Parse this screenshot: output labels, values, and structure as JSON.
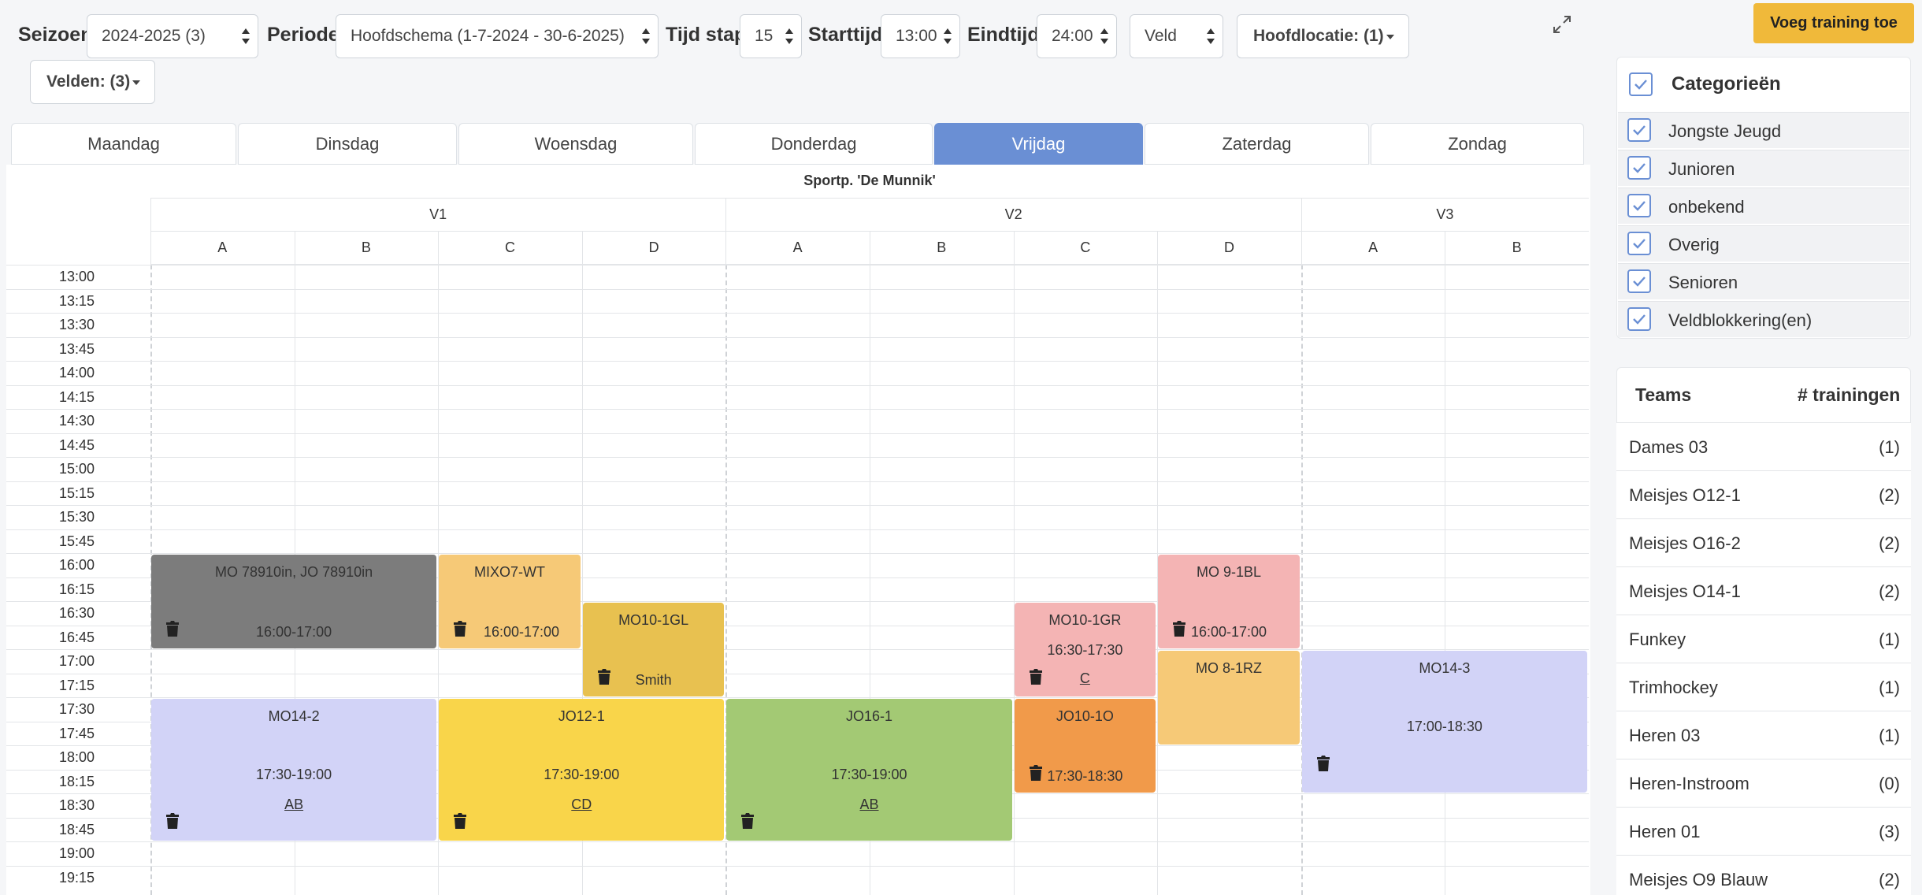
{
  "filters": {
    "season_label": "Seizoen",
    "season_value": "2024-2025 (3)",
    "period_label": "Periode",
    "period_value": "Hoofdschema (1-7-2024 - 30-6-2025)",
    "timestep_label": "Tijd stap",
    "timestep_value": "15",
    "start_label": "Starttijd",
    "start_value": "13:00",
    "end_label": "Eindtijd",
    "end_value": "24:00",
    "view_value": "Veld",
    "location_button": "Hoofdlocatie: (1)",
    "fields_button": "Velden: (3)"
  },
  "days": [
    "Maandag",
    "Dinsdag",
    "Woensdag",
    "Donderdag",
    "Vrijdag",
    "Zaterdag",
    "Zondag"
  ],
  "active_day": "Vrijdag",
  "location": "Sportp. 'De Munnik'",
  "fields": [
    {
      "name": "V1",
      "subfields": [
        "A",
        "B",
        "C",
        "D"
      ]
    },
    {
      "name": "V2",
      "subfields": [
        "A",
        "B",
        "C",
        "D"
      ]
    },
    {
      "name": "V3",
      "subfields": [
        "A",
        "B"
      ]
    }
  ],
  "times": [
    "13:00",
    "13:15",
    "13:30",
    "13:45",
    "14:00",
    "14:15",
    "14:30",
    "14:45",
    "15:00",
    "15:15",
    "15:30",
    "15:45",
    "16:00",
    "16:15",
    "16:30",
    "16:45",
    "17:00",
    "17:15",
    "17:30",
    "17:45",
    "18:00",
    "18:15",
    "18:30",
    "18:45",
    "19:00",
    "19:15"
  ],
  "events": [
    {
      "title": "MO 78910in, JO 78910in",
      "col": 0,
      "span": 2,
      "start": 12,
      "slots": 4,
      "color": "#7c7c7c",
      "time": "16:00-17:00",
      "coach": "",
      "trash": true
    },
    {
      "title": "MIXO7-WT",
      "col": 2,
      "span": 1,
      "start": 12,
      "slots": 4,
      "color": "#f6c977",
      "time": "16:00-17:00",
      "coach": "",
      "trash": true
    },
    {
      "title": "MO10-1GL",
      "col": 3,
      "span": 1,
      "start": 14,
      "slots": 4,
      "color": "#e8c150",
      "time": "",
      "coach": "",
      "note": "Smith",
      "trash": true
    },
    {
      "title": "MO10-1GR",
      "col": 6,
      "span": 1,
      "start": 14,
      "slots": 4,
      "color": "#f4b4b4",
      "time": "16:30-17:30",
      "coach": "C",
      "trash": true
    },
    {
      "title": "MO 9-1BL",
      "col": 7,
      "span": 1,
      "start": 12,
      "slots": 4,
      "color": "#f4b4b4",
      "time": "16:00-17:00",
      "coach": "",
      "trash": true
    },
    {
      "title": "MO 8-1RZ",
      "col": 7,
      "span": 1,
      "start": 16,
      "slots": 4,
      "color": "#f6c977",
      "time": "",
      "coach": "",
      "trash": false
    },
    {
      "title": "MO14-3",
      "col": 8,
      "span": 2,
      "start": 16,
      "slots": 6,
      "color": "#d2d3f7",
      "time": "17:00-18:30",
      "coach": "",
      "trash": true
    },
    {
      "title": "MO14-2",
      "col": 0,
      "span": 2,
      "start": 18,
      "slots": 6,
      "color": "#d2d3f7",
      "time": "17:30-19:00",
      "coach": "AB",
      "trash": true
    },
    {
      "title": "JO12-1",
      "col": 2,
      "span": 2,
      "start": 18,
      "slots": 6,
      "color": "#f9d54a",
      "time": "17:30-19:00",
      "coach": "CD",
      "trash": true
    },
    {
      "title": "JO16-1",
      "col": 4,
      "span": 2,
      "start": 18,
      "slots": 6,
      "color": "#a3c974",
      "time": "17:30-19:00",
      "coach": "AB",
      "trash": true
    },
    {
      "title": "JO10-1O",
      "col": 6,
      "span": 1,
      "start": 18,
      "slots": 4,
      "color": "#f19a4a",
      "time": "17:30-18:30",
      "coach": "",
      "trash": true
    }
  ],
  "add_button": "Voeg training toe",
  "categories": {
    "title": "Categorieën",
    "items": [
      "Jongste Jeugd",
      "Junioren",
      "onbekend",
      "Overig",
      "Senioren",
      "Veldblokkering(en)"
    ],
    "check_color": "#6a8fd4"
  },
  "teams": {
    "header_name": "Teams",
    "header_count": "# trainingen",
    "rows": [
      {
        "name": "Dames 03",
        "count": "(1)"
      },
      {
        "name": "Meisjes O12-1",
        "count": "(2)"
      },
      {
        "name": "Meisjes O16-2",
        "count": "(2)"
      },
      {
        "name": "Meisjes O14-1",
        "count": "(2)"
      },
      {
        "name": "Funkey",
        "count": "(1)"
      },
      {
        "name": "Trimhockey",
        "count": "(1)"
      },
      {
        "name": "Heren 03",
        "count": "(1)"
      },
      {
        "name": "Heren-Instroom",
        "count": "(0)"
      },
      {
        "name": "Heren 01",
        "count": "(3)"
      },
      {
        "name": "Meisjes O9 Blauw",
        "count": "(2)"
      }
    ]
  }
}
